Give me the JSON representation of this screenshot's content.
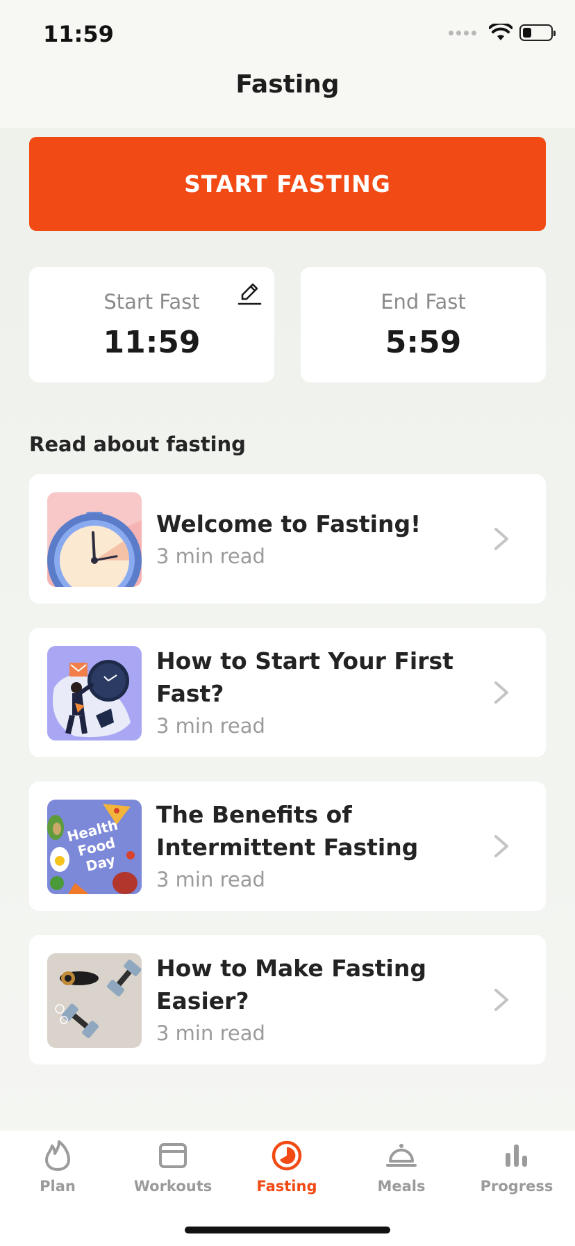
{
  "status_bar": {
    "time": "11:59"
  },
  "header": {
    "title": "Fasting"
  },
  "start_button": {
    "label": "START FASTING"
  },
  "fast_cards": {
    "start": {
      "label": "Start Fast",
      "value": "11:59"
    },
    "end": {
      "label": "End Fast",
      "value": "5:59"
    }
  },
  "articles_section": {
    "title": "Read about fasting",
    "items": [
      {
        "title": "Welcome to Fasting!",
        "meta": "3 min read",
        "thumb": "alarm-clock"
      },
      {
        "title": "How to Start Your First Fast?",
        "meta": "3 min read",
        "thumb": "person-clock"
      },
      {
        "title": "The Benefits of Intermittent Fasting",
        "meta": "3 min read",
        "thumb": "health-food-day"
      },
      {
        "title": "How to Make Fasting Easier?",
        "meta": "3 min read",
        "thumb": "dumbbells-coffee"
      }
    ],
    "thumb_text": "Health Food Day"
  },
  "tabs": [
    {
      "label": "Plan",
      "icon": "flame-icon",
      "active": false
    },
    {
      "label": "Workouts",
      "icon": "calendar-card-icon",
      "active": false
    },
    {
      "label": "Fasting",
      "icon": "fasting-clock-icon",
      "active": true
    },
    {
      "label": "Meals",
      "icon": "cloche-icon",
      "active": false
    },
    {
      "label": "Progress",
      "icon": "bar-chart-icon",
      "active": false
    }
  ],
  "colors": {
    "accent": "#f24a14",
    "inactive_tab": "#9b9b9b"
  }
}
